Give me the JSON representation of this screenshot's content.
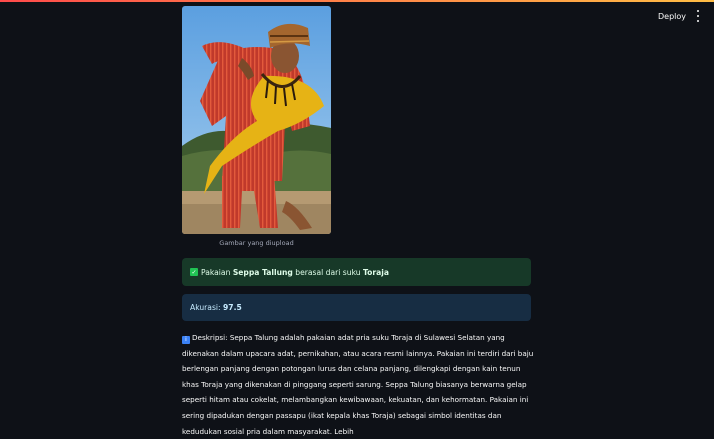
{
  "header": {
    "deploy_label": "Deploy",
    "menu_icon": "kebab-menu-icon"
  },
  "image": {
    "caption": "Gambar yang diupload"
  },
  "result": {
    "prefix": "Pakaian",
    "garment": "Seppa Tallung",
    "middle": "berasal dari suku",
    "tribe": "Toraja",
    "icon": "check-icon",
    "accent": "#21c354"
  },
  "accuracy": {
    "label": "Akurasi:",
    "value": "97.5"
  },
  "description": {
    "icon": "info-icon",
    "text": "Deskripsi: Seppa Talung adalah pakaian adat pria suku Toraja di Sulawesi Selatan yang dikenakan dalam upacara adat, pernikahan, atau acara resmi lainnya. Pakaian ini terdiri dari baju berlengan panjang dengan potongan lurus dan celana panjang, dilengkapi dengan kain tenun khas Toraja yang dikenakan di pinggang seperti sarung. Seppa Talung biasanya berwarna gelap seperti hitam atau cokelat, melambangkan kewibawaan, kekuatan, dan kehormatan. Pakaian ini sering dipadukan dengan passapu (ikat kepala khas Toraja) sebagai simbol identitas dan kedudukan sosial pria dalam masyarakat. Lebih"
  }
}
